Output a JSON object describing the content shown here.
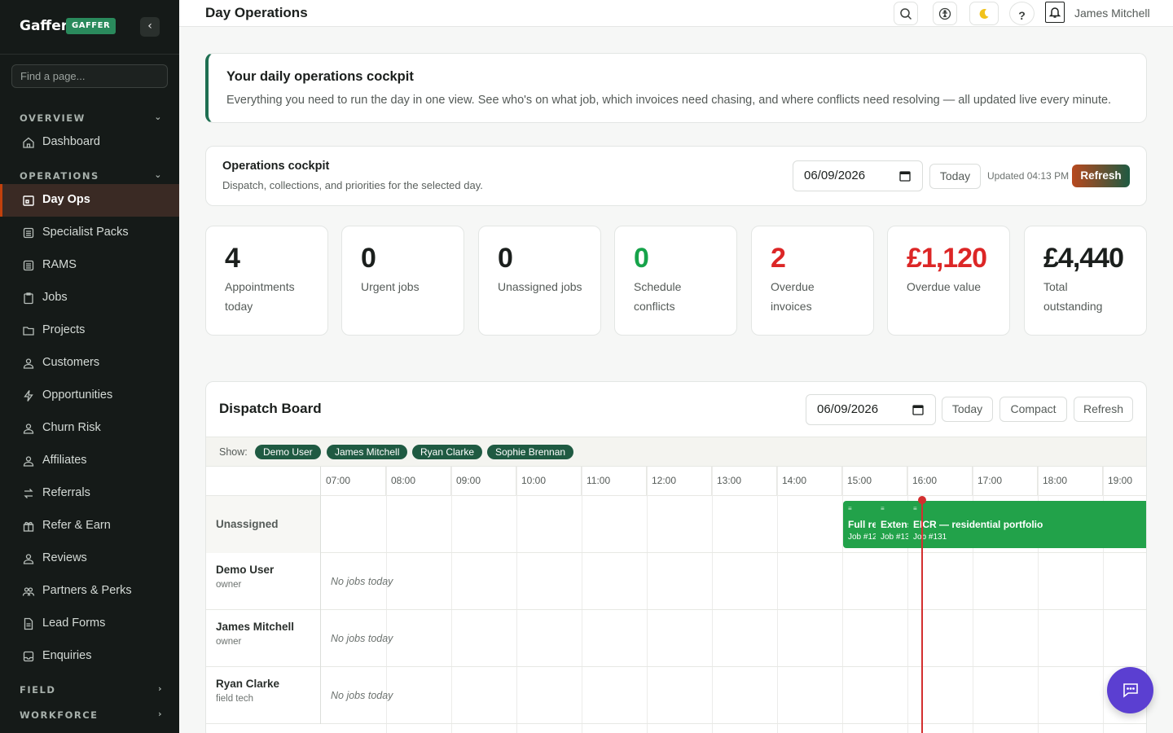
{
  "sidebar": {
    "brand": "Gaffer",
    "badge": "GAFFER",
    "collapse_icon": "‹",
    "search_placeholder": "Find a page...",
    "sections": {
      "overview": "OVERVIEW",
      "operations": "OPERATIONS",
      "field": "FIELD",
      "workforce": "WORKFORCE"
    },
    "items": [
      {
        "label": "Dashboard",
        "icon": "home-icon"
      },
      {
        "label": "Day Ops",
        "icon": "calendar-icon",
        "active": true
      },
      {
        "label": "Specialist Packs",
        "icon": "list-icon"
      },
      {
        "label": "RAMS",
        "icon": "list-icon"
      },
      {
        "label": "Jobs",
        "icon": "clipboard-icon"
      },
      {
        "label": "Projects",
        "icon": "folder-icon"
      },
      {
        "label": "Customers",
        "icon": "users-icon"
      },
      {
        "label": "Opportunities",
        "icon": "bolt-icon"
      },
      {
        "label": "Churn Risk",
        "icon": "users-icon"
      },
      {
        "label": "Affiliates",
        "icon": "users-icon"
      },
      {
        "label": "Referrals",
        "icon": "swap-icon"
      },
      {
        "label": "Refer & Earn",
        "icon": "gift-icon"
      },
      {
        "label": "Reviews",
        "icon": "users-icon"
      },
      {
        "label": "Partners & Perks",
        "icon": "users-icon"
      },
      {
        "label": "Lead Forms",
        "icon": "document-icon"
      },
      {
        "label": "Enquiries",
        "icon": "inbox-icon"
      }
    ]
  },
  "topbar": {
    "title": "Day Operations",
    "user": "James Mitchell",
    "help": "?"
  },
  "intro": {
    "title": "Your daily operations cockpit",
    "text": "Everything you need to run the day in one view. See who's on what job, which invoices need chasing, and where conflicts need resolving — all updated live every minute."
  },
  "cockpit": {
    "title": "Operations cockpit",
    "subtitle": "Dispatch, collections, and priorities for the selected day.",
    "date": "06/09/2026",
    "today": "Today",
    "updated": "Updated 04:13 PM",
    "refresh": "Refresh"
  },
  "stats": [
    {
      "value": "4",
      "label": "Appointments today",
      "color": "#1b1f1d"
    },
    {
      "value": "0",
      "label": "Urgent jobs",
      "color": "#1b1f1d"
    },
    {
      "value": "0",
      "label": "Unassigned jobs",
      "color": "#1b1f1d"
    },
    {
      "value": "0",
      "label": "Schedule conflicts",
      "color": "#16a34a"
    },
    {
      "value": "2",
      "label": "Overdue invoices",
      "color": "#dc2626"
    },
    {
      "value": "£1,120",
      "label": "Overdue value",
      "color": "#dc2626"
    },
    {
      "value": "£4,440",
      "label": "Total outstanding",
      "color": "#1b1f1d"
    }
  ],
  "board": {
    "title": "Dispatch Board",
    "date": "06/09/2026",
    "today": "Today",
    "compact": "Compact",
    "refresh": "Refresh",
    "show_label": "Show:",
    "chips": [
      "Demo User",
      "James Mitchell",
      "Ryan Clarke",
      "Sophie Brennan"
    ],
    "hours": [
      "07:00",
      "08:00",
      "09:00",
      "10:00",
      "11:00",
      "12:00",
      "13:00",
      "14:00",
      "15:00",
      "16:00",
      "17:00",
      "18:00",
      "19:00"
    ],
    "rows": [
      {
        "name": "Unassigned",
        "role": ""
      },
      {
        "name": "Demo User",
        "role": "owner",
        "empty": "No jobs today"
      },
      {
        "name": "James Mitchell",
        "role": "owner",
        "empty": "No jobs today"
      },
      {
        "name": "Ryan Clarke",
        "role": "field tech",
        "empty": "No jobs today"
      }
    ],
    "jobs": [
      {
        "title": "Full re",
        "sub": "Job #12",
        "handle": "≡"
      },
      {
        "title": "Extens",
        "sub": "Job #13",
        "handle": "≡"
      },
      {
        "title": "EICR — residential portfolio",
        "sub": "Job #131",
        "handle": "≡"
      }
    ]
  },
  "colors": {
    "accent": "#1f5a42",
    "active_border": "#c2410c",
    "job_green": "#22a24a",
    "now_line": "#d32f2f",
    "chat": "#5b3fd1"
  }
}
